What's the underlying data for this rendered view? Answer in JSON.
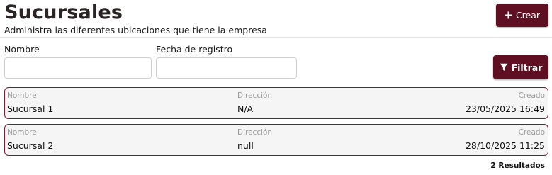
{
  "header": {
    "title": "Sucursales",
    "subtitle": "Administra las diferentes ubicaciones que tiene la empresa",
    "create_label": "Crear",
    "create_icon": "plus-icon"
  },
  "filters": {
    "name_label": "Nombre",
    "name_value": "",
    "date_label": "Fecha de registro",
    "date_value": "",
    "filter_label": "Filtrar",
    "filter_icon": "funnel-icon"
  },
  "table": {
    "columns": [
      "Nombre",
      "Dirección",
      "Creado"
    ],
    "rows": [
      {
        "name": "Sucursal 1",
        "address": "N/A",
        "created": "23/05/2025 16:49"
      },
      {
        "name": "Sucursal 2",
        "address": "null",
        "created": "28/10/2025 11:25"
      }
    ]
  },
  "results_text": "2 Resultados",
  "colors": {
    "accent": "#5e0f22",
    "card_border": "#7a1a33",
    "card_bg": "#f5f5f5"
  }
}
